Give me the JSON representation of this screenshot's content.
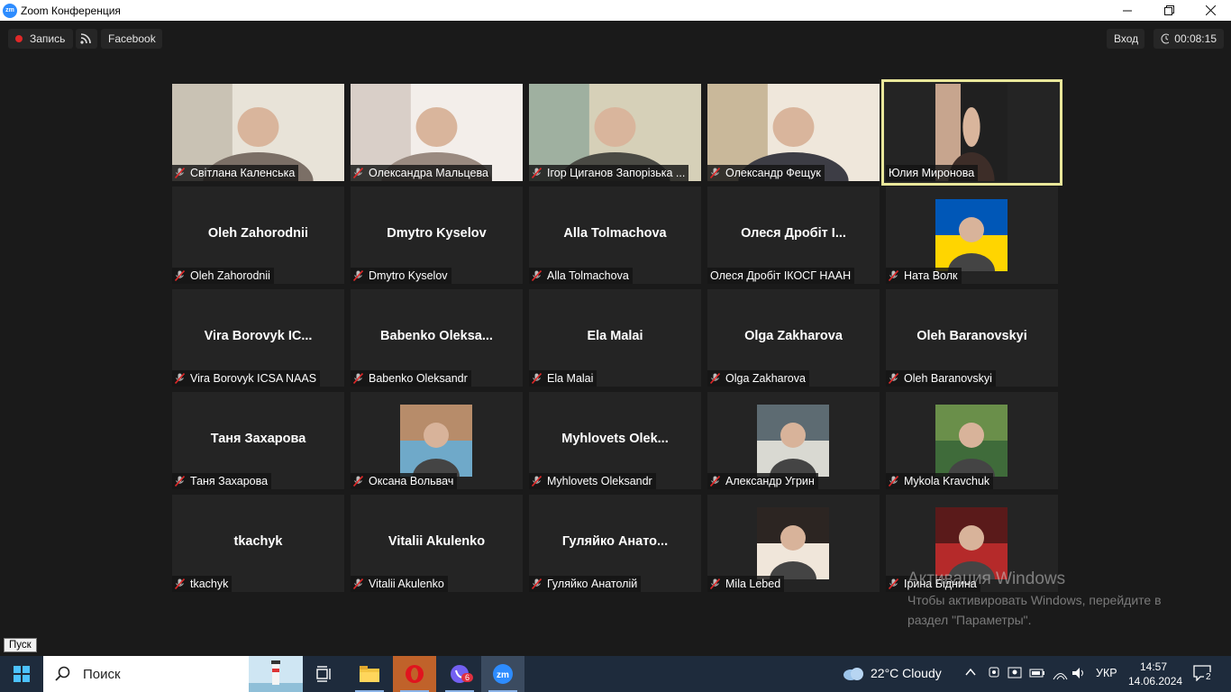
{
  "window": {
    "title": "Zoom Конференция",
    "app_icon": "zm",
    "controls": [
      "minimize-icon",
      "restore-icon",
      "close-icon"
    ]
  },
  "toolbar": {
    "record_label": "Запись",
    "facebook_label": "Facebook",
    "login_label": "Вход",
    "timer": "00:08:15"
  },
  "participants": [
    {
      "name": "Світлана Каленська",
      "video": true,
      "muted": true
    },
    {
      "name": "Олександра Мальцева",
      "video": true,
      "muted": true
    },
    {
      "name": "Ігор Циганов Запорізька ...",
      "video": true,
      "muted": true
    },
    {
      "name": "Олександр Фещук",
      "video": true,
      "muted": true
    },
    {
      "name": "Юлия Миронова",
      "video": true,
      "muted": false,
      "active_speaker": true
    },
    {
      "name": "Oleh Zahorodnii",
      "display": "Oleh Zahorodnii",
      "muted": true
    },
    {
      "name": "Dmytro Kyselov",
      "display": "Dmytro Kyselov",
      "muted": true
    },
    {
      "name": "Alla Tolmachova",
      "display": "Alla Tolmachova",
      "muted": true
    },
    {
      "name": "Олеся Дробіт ІКОСГ НААН",
      "display": "Олеся  Дробіт І...",
      "muted": false
    },
    {
      "name": "Ната Волк",
      "avatar": true,
      "muted": true
    },
    {
      "name": "Vira Borovyk ICSA NAAS",
      "display": "Vira  Borovyk  IC...",
      "muted": true
    },
    {
      "name": "Babenko Oleksandr",
      "display": "Babenko  Oleksa...",
      "muted": true
    },
    {
      "name": "Ela Malai",
      "display": "Ela Malai",
      "muted": true
    },
    {
      "name": "Olga Zakharova",
      "display": "Olga Zakharova",
      "muted": true
    },
    {
      "name": "Oleh Baranovskyi",
      "display": "Oleh Baranovskyi",
      "muted": true
    },
    {
      "name": "Таня  Захарова",
      "display": "Таня  Захарова",
      "muted": true
    },
    {
      "name": "Оксана Вольвач",
      "avatar": true,
      "muted": true
    },
    {
      "name": "Myhlovets Oleksandr",
      "display": "Myhlovets  Olek...",
      "muted": true
    },
    {
      "name": "Александр Угрин",
      "avatar": true,
      "muted": true
    },
    {
      "name": "Mykola Kravchuk",
      "avatar": true,
      "muted": true
    },
    {
      "name": "tkachyk",
      "display": "tkachyk",
      "muted": true
    },
    {
      "name": "Vitalii Akulenko",
      "display": "Vitalii Akulenko",
      "muted": true
    },
    {
      "name": "Гуляйко Анатолій",
      "display": "Гуляйко  Анато...",
      "muted": true
    },
    {
      "name": "Mila Lebed",
      "avatar": true,
      "muted": true
    },
    {
      "name": "Ірина Біднина",
      "avatar": true,
      "muted": true
    }
  ],
  "activation": {
    "title": "Активация Windows",
    "line1": "Чтобы активировать Windows, перейдите в",
    "line2": "раздел \"Параметры\"."
  },
  "tooltip": "Пуск",
  "taskbar": {
    "search_placeholder": "Поиск",
    "apps": [
      "task-view-icon",
      "file-explorer-icon",
      "opera-icon",
      "viber-icon",
      "zoom-icon"
    ],
    "viber_badge": "6",
    "weather": "22°C  Cloudy",
    "language": "УКР",
    "time": "14:57",
    "date": "14.06.2024",
    "notifications": "2"
  },
  "colors": {
    "active_speaker_border": "#e9e79a",
    "record_dot": "#e02828",
    "mute_icon": "#e02828",
    "zoom_blue": "#2d8cff"
  }
}
